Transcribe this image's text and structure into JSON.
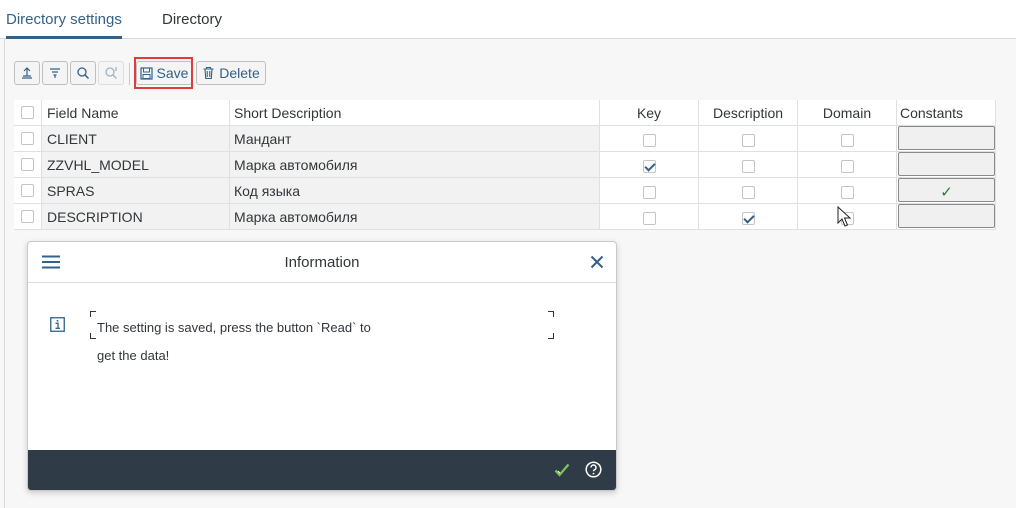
{
  "tabs": [
    {
      "label": "Directory settings",
      "active": true
    },
    {
      "label": "Directory",
      "active": false
    }
  ],
  "toolbar": {
    "save_label": "Save",
    "delete_label": "Delete",
    "accent_color": "#346187",
    "highlight_color": "#e03c3c"
  },
  "table": {
    "columns": [
      "Field Name",
      "Short Description",
      "Key",
      "Description",
      "Domain",
      "Constants"
    ],
    "rows": [
      {
        "field": "CLIENT",
        "short_description": "Мандант",
        "key": false,
        "description": false,
        "domain": false,
        "constants": false
      },
      {
        "field": "ZZVHL_MODEL",
        "short_description": "Марка автомобиля",
        "key": true,
        "description": false,
        "domain": false,
        "constants": false
      },
      {
        "field": "SPRAS",
        "short_description": "Код языка",
        "key": false,
        "description": false,
        "domain": false,
        "constants": true
      },
      {
        "field": "DESCRIPTION",
        "short_description": "Марка автомобиля",
        "key": false,
        "description": true,
        "domain": false,
        "constants": false
      }
    ]
  },
  "dialog": {
    "title": "Information",
    "message_line1": "The setting is saved, press the button `Read` to",
    "message_line2": "get the data!",
    "footer_color": "#2f3c48"
  }
}
